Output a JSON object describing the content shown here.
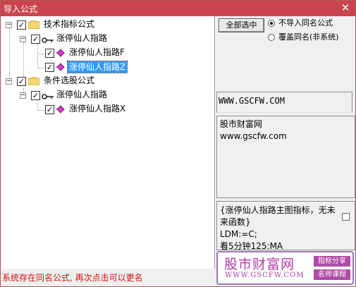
{
  "window": {
    "title": "导入公式"
  },
  "tree": {
    "group1": "技术指标公式",
    "group1_sub": "涨停仙人指路",
    "item1": "涨停仙人指路F",
    "item2": "涨停仙人指路Z",
    "group2": "条件选股公式",
    "group2_sub": "涨停仙人指路",
    "item3": "涨停仙人指路X"
  },
  "controls": {
    "select_all_label": "全部选中",
    "radio_no_import": "不导入同名公式",
    "radio_overwrite": "覆盖同名(非系统)",
    "selected_option": "不导入同名公式"
  },
  "site": "WWW.GSCFW.COM",
  "info": {
    "line1": "股市财富网",
    "line2": "www.gscfw.com"
  },
  "code": {
    "line1": "{涨停仙人指路主图指标，无未",
    "line2": "来函数}",
    "line3": "LDM:=C;",
    "line4": "看5分钟125:MA"
  },
  "status": "系统存在同名公式, 再次点击可以更名",
  "watermark": {
    "title": "股市财富网",
    "url": "WWW.GSCFW.COM",
    "tag1": "指标分享",
    "tag2": "名师课程"
  },
  "colors": {
    "titlebar": "#c9444e",
    "selection": "#3399ff",
    "status": "#d01010",
    "watermark": "#b03aa5"
  },
  "icons": {
    "folder": "folder-icon",
    "formula": "formula-gem-icon",
    "group": "key-icon"
  }
}
